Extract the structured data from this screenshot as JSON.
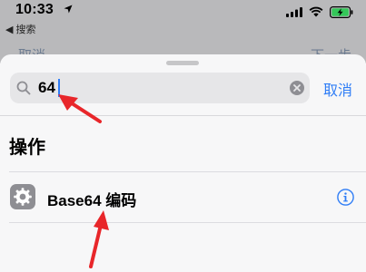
{
  "status_bar": {
    "time": "10:33",
    "back_app": "◀ 搜索"
  },
  "background_nav": {
    "left_label": "取消",
    "right_label": "下一步"
  },
  "search": {
    "query": "64"
  },
  "cancel_label": "取消",
  "section": {
    "title": "操作"
  },
  "results": [
    {
      "title": "Base64 编码",
      "icon": "gear-icon"
    }
  ],
  "colors": {
    "accent": "#2f7df6",
    "annotation_arrow": "#e8262a",
    "battery": "#34c759"
  }
}
